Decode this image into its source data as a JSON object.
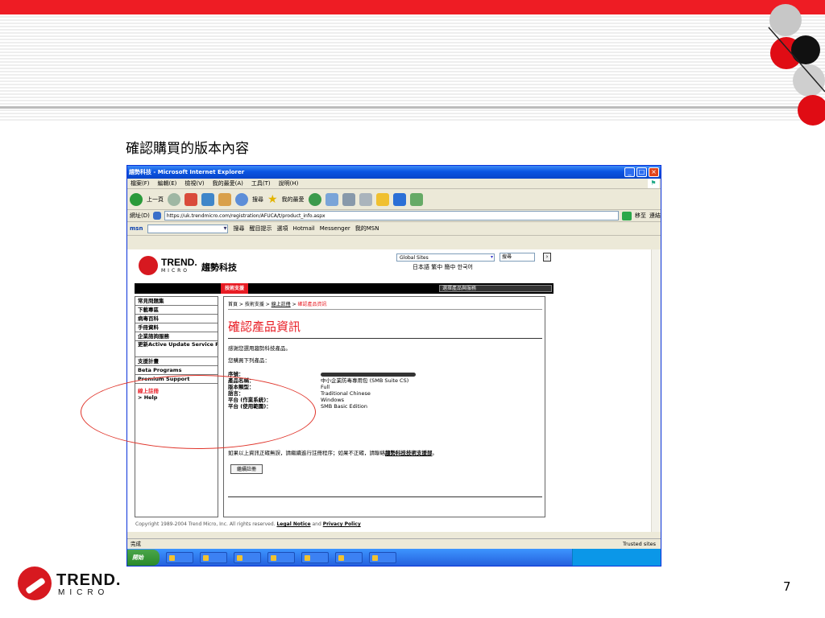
{
  "slide": {
    "title": "確認購買的版本內容",
    "page_number": "7",
    "logo_top": "TREND.",
    "logo_bottom": "MICRO",
    "accent_color": "#ee1c24"
  },
  "browser": {
    "title": "趨勢科技 - Microsoft Internet Explorer",
    "menu": [
      "檔案(F)",
      "編輯(E)",
      "檢視(V)",
      "我的最愛(A)",
      "工具(T)",
      "說明(H)"
    ],
    "toolbar": {
      "back": "上一頁",
      "search": "搜尋",
      "favorites": "我的最愛"
    },
    "address_label": "網址(D)",
    "address_url": "https://uk.trendmicro.com/registration/AFUCA/t/product_info.aspx",
    "go_label": "移至",
    "links_label": "連結",
    "toolbar2": {
      "search": "搜尋",
      "highlight": "醒目提示",
      "options": "選項",
      "hotmail": "Hotmail",
      "messenger": "Messenger",
      "my_msn": "我的MSN"
    },
    "status_left": "完成",
    "status_right": "Trusted sites"
  },
  "site": {
    "logo_name": "TREND.",
    "logo_sub": "MICRO",
    "logo_cn": "趨勢科技",
    "region_select": "Global Sites",
    "languages": "日本語  繁中  簡中  한국어",
    "search_placeholder": "搜尋",
    "nav_active": "技術支援",
    "nav_dropdown": "選擇產品與服務",
    "left_nav": [
      "常見問題集",
      "下載專區",
      "病毒百科",
      "手冊資料",
      "企業諮詢服務",
      "更新Active Update Service Pack",
      "支援計畫",
      "Beta Programs",
      "Premium Support"
    ],
    "left_nav_current": "線上註冊",
    "left_nav_help": "> Help",
    "breadcrumb": {
      "home": "首頁 > 技術支援 > ",
      "link": "線上註冊",
      "sep": " > ",
      "current": "確認產品資訊"
    },
    "heading": "確認產品資訊",
    "intro": "感謝您選用趨勢科技產品。",
    "subhead": "您購買下列產品：",
    "product_rows": [
      {
        "label": "序號：",
        "value": ""
      },
      {
        "label": "產品名稱：",
        "value": "中小企業防毒專用包 (SMB Suite CS)"
      },
      {
        "label": "版本類型：",
        "value": "Full"
      },
      {
        "label": "語言：",
        "value": "Traditional Chinese"
      },
      {
        "label": "平台 (作業系統)：",
        "value": "Windows"
      },
      {
        "label": "平台 (使用範圍)：",
        "value": "SMB Basic Edition"
      }
    ],
    "confirm_text": "如果以上資訊正確無誤，請繼續進行註冊程序；如果不正確，請聯絡",
    "confirm_link": "趨勢科技技術支援部",
    "confirm_end": "。",
    "register_button": "繼續註冊",
    "copyright": "Copyright 1989-2004 Trend Micro, Inc. All rights reserved.",
    "legal_notice": "Legal Notice",
    "and": "and",
    "privacy_policy": "Privacy Policy"
  },
  "taskbar": {
    "start": "開始"
  }
}
